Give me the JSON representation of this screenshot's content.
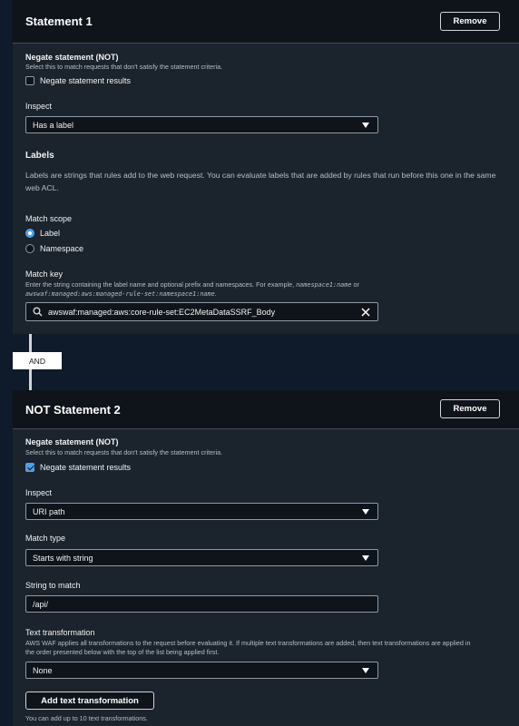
{
  "statement1": {
    "title": "Statement 1",
    "remove_label": "Remove",
    "negate": {
      "label": "Negate statement (NOT)",
      "description": "Select this to match requests that don't satisfy the statement criteria.",
      "checkbox_label": "Negate statement results",
      "checked": false
    },
    "inspect": {
      "label": "Inspect",
      "value": "Has a label"
    },
    "labels": {
      "heading": "Labels",
      "description": "Labels are strings that rules add to the web request. You can evaluate labels that are added by rules that run before this one in the same web ACL."
    },
    "match_scope": {
      "label": "Match scope",
      "options": [
        "Label",
        "Namespace"
      ],
      "selected": "Label"
    },
    "match_key": {
      "label": "Match key",
      "description_prefix": "Enter the string containing the label name and optional prefix and namespaces. For example,",
      "example1": "namespace1:name",
      "or": "or",
      "example2": "awswaf:managed:aws:managed-rule-set:namespace1:name",
      "value": "awswaf:managed:aws:core-rule-set:EC2MetaDataSSRF_Body"
    }
  },
  "connector": {
    "label": "AND"
  },
  "statement2": {
    "title": "NOT Statement 2",
    "remove_label": "Remove",
    "negate": {
      "label": "Negate statement (NOT)",
      "description": "Select this to match requests that don't satisfy the statement criteria.",
      "checkbox_label": "Negate statement results",
      "checked": true
    },
    "inspect": {
      "label": "Inspect",
      "value": "URI path"
    },
    "match_type": {
      "label": "Match type",
      "value": "Starts with string"
    },
    "string_to_match": {
      "label": "String to match",
      "value": "/api/"
    },
    "text_transformation": {
      "label": "Text transformation",
      "description": "AWS WAF applies all transformations to the request before evaluating it. If multiple text transformations are added, then text transformations are applied in the order presented below with the top of the list being applied first.",
      "value": "None",
      "add_button": "Add text transformation",
      "limit_note": "You can add up to 10 text transformations."
    }
  },
  "colors": {
    "background": "#0f1b2a",
    "panel": "#1b232d",
    "header": "#0f141a",
    "accent": "#539fe5"
  },
  "icons": [
    "search-icon",
    "clear-icon",
    "caret-down-icon",
    "checkmark-icon"
  ]
}
